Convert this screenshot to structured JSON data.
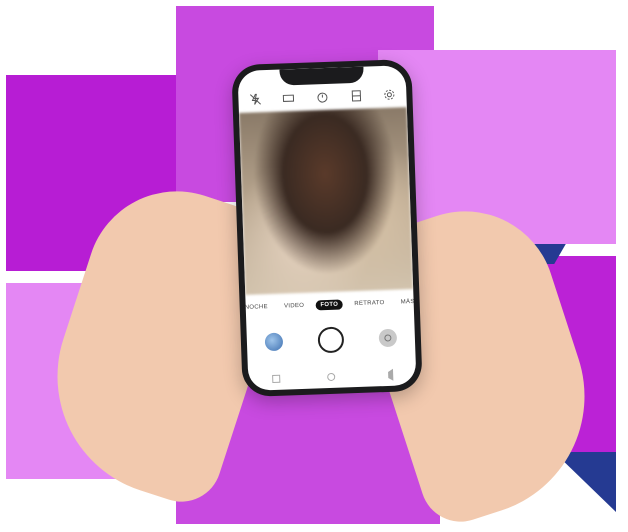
{
  "camera": {
    "modes": [
      "NOCHE",
      "VIDEO",
      "FOTO",
      "RETRATO",
      "MÁS"
    ],
    "active_mode": "FOTO",
    "top_icons": [
      "flash-off-icon",
      "aspect-ratio-icon",
      "timer-icon",
      "hdr-icon",
      "settings-icon"
    ]
  },
  "colors": {
    "magenta_dark": "#b71dd4",
    "magenta_mid": "#c84ae0",
    "magenta_light": "#e487f4",
    "navy": "#253a92"
  }
}
